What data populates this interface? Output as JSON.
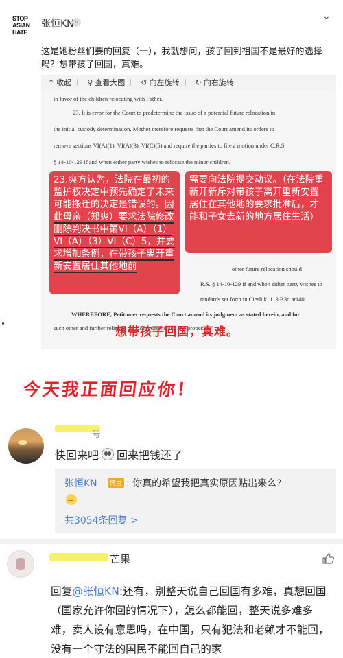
{
  "post": {
    "logo_lines": [
      "STOP",
      "ASIAN",
      "HATE"
    ],
    "author": "张恒KN",
    "vip_icon": "v",
    "text": "这是她粉丝们要的回复（一），我就想问，孩子回到祖国不是最好的选择吗？想带孩子回国，真难。",
    "toolbar": {
      "collapse": "收起",
      "view_large": "查看大图",
      "rotate_left": "向左旋转",
      "rotate_right": "向右旋转"
    }
  },
  "document": {
    "lines": [
      "in favor of the children relocating with Father.",
      "23.     It is error for the Court to predetermine the issue of a potential future relocation in",
      "the initial custody determination. Mother therefore requests that the Court amend its orders to",
      "remove sections VI(A)(1), VI(A)(3), VI(C)(5) and require the parties to file a motion under C.R.S.",
      "§ 14-10-129 if and when either party wishes to relocate the minor children.",
      "other future relocation should",
      "R.S. § 14-10-129 if and when either party wishes to",
      "tandards set forth in Ciesluk. 113 P.3d at140.",
      "WHEREFORE, Petitioner requests the Court amend its judgment as stated herein, and for",
      "such other and further relief as the Court deems just and proper."
    ],
    "note_left_plain": "23.爽方认为，法院在最初的监护权决定中预先确定了未来可能搬迁的决定是错误的。",
    "note_left_underlined": "因此母亲（郑爽）要求法院修改删除判决书中第VI（A）（1）VI（A）（3）VI（C）5，并要求增加条例，在带孩子离开重新安置居住其他地前",
    "note_right": "需要向法院提交动议。（在法院重新开新斥对带孩子离开重新安置居住在其他地的要求批准后，才能和子女去新的地方居住生活）",
    "caption": "想带孩子回国，真难。"
  },
  "banner": {
    "text": "今天我正面回应你！"
  },
  "comment1": {
    "name_partial": "号",
    "text_before": "快回来吧",
    "text_after": "回来把钱还了",
    "reply": {
      "author": "张恒KN",
      "badge": "博主",
      "text": ": 你真的希望我把真实原因贴出来么?"
    },
    "reply_count": "共3054条回复 >"
  },
  "comment2": {
    "name_partial": "芒果",
    "reply_prefix": "回复",
    "mention": "@张恒KN",
    "text": ":还有，别整天说自己回国有多难，真想回国（国家允许你回的情况下），怎么都能回，整天说多难多难，卖人设有意思吗，在中国，只有犯法和老赖才不能回，没有一个守法的国民不能回自己的家"
  },
  "colors": {
    "link_blue": "#4a7fc1",
    "accent_red": "#e0242c",
    "note_red": "#e13b44",
    "highlight_yellow": "#f7f06a"
  }
}
